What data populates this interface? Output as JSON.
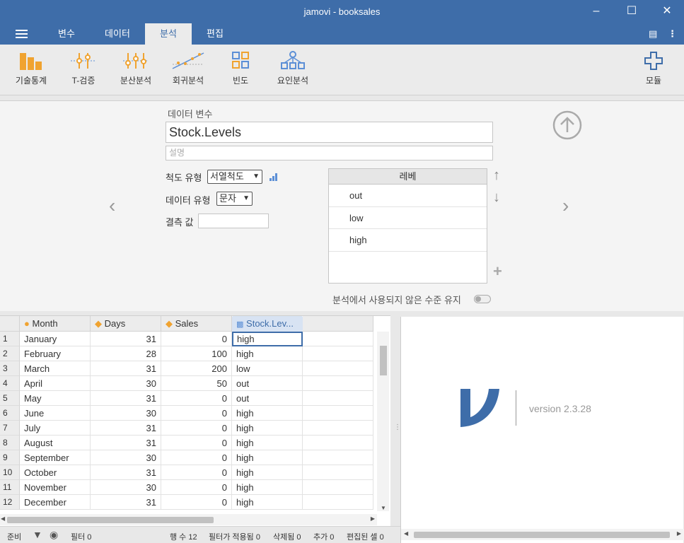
{
  "window": {
    "title": "jamovi - booksales"
  },
  "tabs": [
    {
      "label": "변수"
    },
    {
      "label": "데이터"
    },
    {
      "label": "분석"
    },
    {
      "label": "편집"
    }
  ],
  "ribbon": {
    "buttons": [
      {
        "label": "기술통계",
        "icon": "bar-chart-icon"
      },
      {
        "label": "T-검증",
        "icon": "ttest-icon"
      },
      {
        "label": "분산분석",
        "icon": "anova-icon"
      },
      {
        "label": "회귀분석",
        "icon": "regression-icon"
      },
      {
        "label": "빈도",
        "icon": "frequencies-icon"
      },
      {
        "label": "요인분석",
        "icon": "factor-icon"
      }
    ],
    "modules_label": "모듈"
  },
  "variable_editor": {
    "section_label": "데이터 변수",
    "name_value": "Stock.Levels",
    "description_placeholder": "설명",
    "measure_type_label": "척도 유형",
    "measure_type_value": "서열척도",
    "data_type_label": "데이터 유형",
    "data_type_value": "문자",
    "missing_label": "결측 값",
    "levels_header": "레베",
    "levels": [
      "out",
      "low",
      "high"
    ],
    "retain_unused_label": "분석에서 사용되지 않은 수준 유지"
  },
  "spreadsheet": {
    "columns": [
      "Month",
      "Days",
      "Sales",
      "Stock.Lev..."
    ],
    "rows": [
      [
        "January",
        "31",
        "0",
        "high"
      ],
      [
        "February",
        "28",
        "100",
        "high"
      ],
      [
        "March",
        "31",
        "200",
        "low"
      ],
      [
        "April",
        "30",
        "50",
        "out"
      ],
      [
        "May",
        "31",
        "0",
        "out"
      ],
      [
        "June",
        "30",
        "0",
        "high"
      ],
      [
        "July",
        "31",
        "0",
        "high"
      ],
      [
        "August",
        "31",
        "0",
        "high"
      ],
      [
        "September",
        "30",
        "0",
        "high"
      ],
      [
        "October",
        "31",
        "0",
        "high"
      ],
      [
        "November",
        "30",
        "0",
        "high"
      ],
      [
        "December",
        "31",
        "0",
        "high"
      ]
    ],
    "row_numbers": [
      "1",
      "2",
      "3",
      "4",
      "5",
      "6",
      "7",
      "8",
      "9",
      "10",
      "11",
      "12"
    ]
  },
  "results": {
    "version": "version 2.3.28"
  },
  "status": {
    "ready": "준비",
    "filters": "필터 0",
    "row_count": "행 수 12",
    "filtered": "필터가 적용됨 0",
    "deleted": "삭제됨 0",
    "added": "추가 0",
    "edited": "편집된 셀 0"
  },
  "colors": {
    "brand": "#3e6da9",
    "accent_orange": "#f0a330"
  }
}
